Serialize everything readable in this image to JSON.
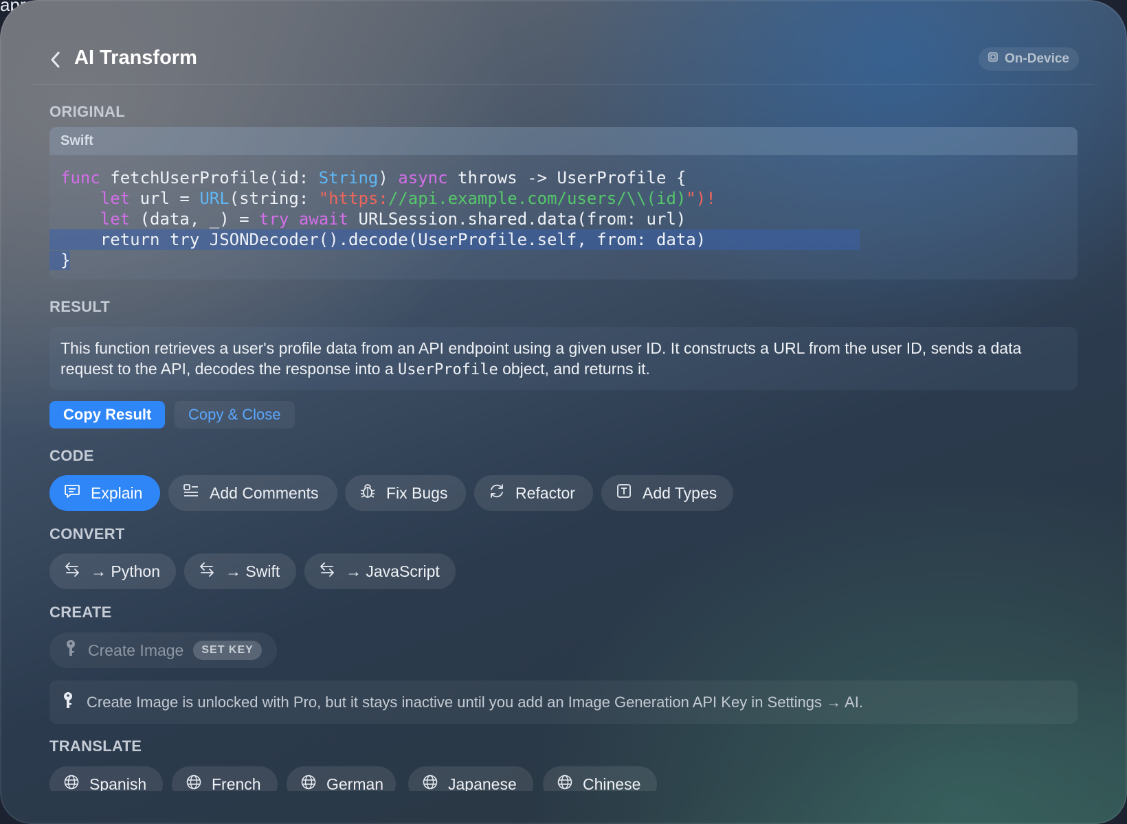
{
  "desktop": {
    "partial_text": "apr"
  },
  "header": {
    "back_icon": "chevron-left-icon",
    "title": "AI Transform",
    "badge_icon": "chip-icon",
    "badge_label": "On-Device"
  },
  "original": {
    "label": "ORIGINAL",
    "language": "Swift",
    "code_lines": [
      "func fetchUserProfile(id: String) async throws -> UserProfile {",
      "    let url = URL(string: \"https://api.example.com/users/\\\\(id)\")!",
      "    let (data, _) = try await URLSession.shared.data(from: url)",
      "    return try JSONDecoder().decode(UserProfile.self, from: data)",
      "}"
    ]
  },
  "result": {
    "label": "RESULT",
    "text_before": "This function retrieves a user's profile data from an API endpoint using a given user ID. It constructs a URL from the user ID, sends a data request to the API, decodes the response into a ",
    "text_code": "UserProfile",
    "text_after": " object, and returns it.",
    "copy_result": "Copy Result",
    "copy_close": "Copy & Close"
  },
  "code_section": {
    "label": "CODE",
    "actions": [
      {
        "label": "Explain",
        "icon": "chat-icon",
        "active": true
      },
      {
        "label": "Add Comments",
        "icon": "list-comment-icon",
        "active": false
      },
      {
        "label": "Fix Bugs",
        "icon": "bug-icon",
        "active": false
      },
      {
        "label": "Refactor",
        "icon": "refresh-icon",
        "active": false
      },
      {
        "label": "Add Types",
        "icon": "type-box-icon",
        "active": false
      }
    ]
  },
  "convert": {
    "label": "CONVERT",
    "actions": [
      {
        "label": "→ Python",
        "icon": "swap-arrows-icon"
      },
      {
        "label": "→ Swift",
        "icon": "swap-arrows-icon"
      },
      {
        "label": "→ JavaScript",
        "icon": "swap-arrows-icon"
      }
    ]
  },
  "create": {
    "label": "CREATE",
    "action": {
      "label": "Create Image",
      "icon": "key-icon",
      "badge": "SET KEY"
    },
    "info_icon": "key-icon",
    "info_text": "Create Image is unlocked with Pro, but it stays inactive until you add an Image Generation API Key in Settings → AI."
  },
  "translate": {
    "label": "TRANSLATE",
    "actions": [
      {
        "label": "Spanish",
        "icon": "globe-icon"
      },
      {
        "label": "French",
        "icon": "globe-icon"
      },
      {
        "label": "German",
        "icon": "globe-icon"
      },
      {
        "label": "Japanese",
        "icon": "globe-icon"
      },
      {
        "label": "Chinese",
        "icon": "globe-icon"
      }
    ]
  },
  "colors": {
    "accent": "#2f86f6",
    "keyword": "#d36fe8",
    "type": "#5fb8f6",
    "string_red": "#f0665a",
    "string_green": "#56c76b"
  }
}
